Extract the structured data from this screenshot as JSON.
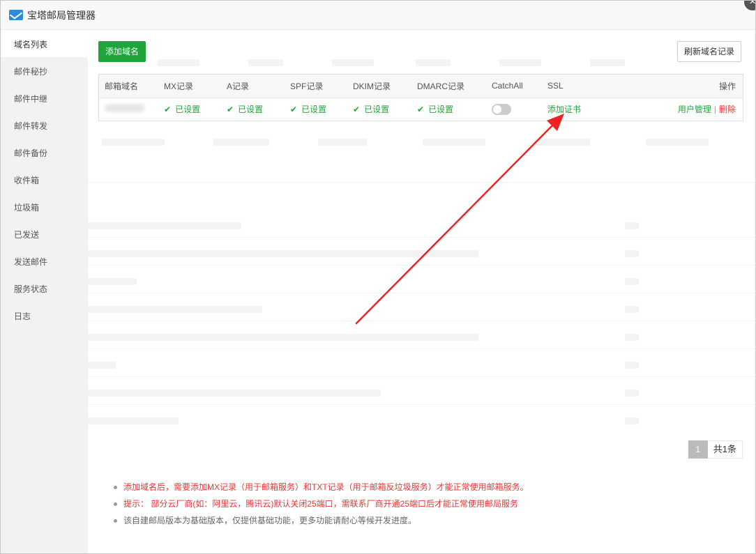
{
  "window": {
    "title": "宝塔邮局管理器",
    "close_label": "×"
  },
  "sidebar": {
    "items": [
      {
        "label": "域名列表",
        "active": true
      },
      {
        "label": "邮件秘抄"
      },
      {
        "label": "邮件中继"
      },
      {
        "label": "邮件转发"
      },
      {
        "label": "邮件备份"
      },
      {
        "label": "收件箱"
      },
      {
        "label": "垃圾箱"
      },
      {
        "label": "已发送"
      },
      {
        "label": "发送邮件"
      },
      {
        "label": "服务状态"
      },
      {
        "label": "日志"
      }
    ]
  },
  "toolbar": {
    "add_label": "添加域名",
    "refresh_label": "刷新域名记录"
  },
  "table": {
    "headers": [
      "邮箱域名",
      "MX记录",
      "A记录",
      "SPF记录",
      "DKIM记录",
      "DMARC记录",
      "CatchAll",
      "SSL",
      "操作"
    ],
    "row": {
      "mx": "已设置",
      "a": "已设置",
      "spf": "已设置",
      "dkim": "已设置",
      "dmarc": "已设置",
      "ssl_action": "添加证书",
      "user_manage": "用户管理",
      "separator": "|",
      "delete": "删除"
    }
  },
  "pagination": {
    "current": "1",
    "total": "共1条"
  },
  "notes": [
    "添加域名后，需要添加MX记录（用于邮箱服务）和TXT记录（用于邮箱反垃圾服务）才能正常使用邮箱服务。",
    "提示：  部分云厂商(如：阿里云，腾讯云)默认关闭25端口，需联系厂商开通25端口后才能正常使用邮局服务",
    "该自建邮局版本为基础版本，仅提供基础功能，更多功能请耐心等候开发进度。"
  ],
  "colors": {
    "accent": "#20a53a",
    "danger": "#ee3333",
    "annotation_arrow": "#ee2222"
  },
  "icons": {
    "check": "✔",
    "app": "mail-icon"
  }
}
